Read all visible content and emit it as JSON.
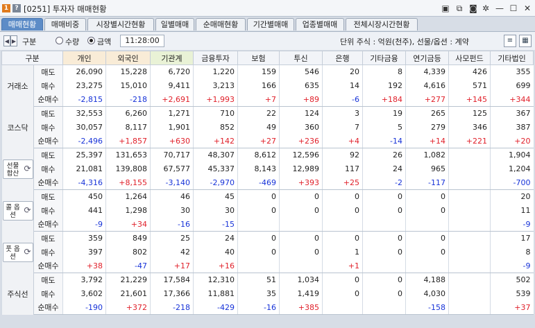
{
  "window": {
    "title": "[0251] 투자자 매매현황",
    "badge1": "1",
    "badge2": "?"
  },
  "tabs": [
    "매매현황",
    "매매비중",
    "시장별시간현황",
    "일별매매",
    "순매매현황",
    "기간별매매",
    "업종별매매",
    "전체시장시간현황"
  ],
  "toolbar": {
    "gubun_label": "구분",
    "radio_qty": "수량",
    "radio_amt": "금액",
    "time": "11:28:00",
    "unit_text": "단위 주식 : 억원(천주), 선물/옵션 : 계약"
  },
  "table": {
    "headers": [
      "구분",
      "개인",
      "외국인",
      "기관계",
      "금융투자",
      "보험",
      "투신",
      "은행",
      "기타금융",
      "연기금등",
      "사모펀드",
      "기타법인"
    ],
    "row_labels": [
      "매도",
      "매수",
      "순매수"
    ],
    "groups": [
      {
        "name": "거래소",
        "rows": [
          [
            "26,090",
            "15,228",
            "6,720",
            "1,220",
            "159",
            "546",
            "20",
            "8",
            "4,339",
            "426",
            "355"
          ],
          [
            "23,275",
            "15,010",
            "9,411",
            "3,213",
            "166",
            "635",
            "14",
            "192",
            "4,616",
            "571",
            "699"
          ],
          [
            "-2,815",
            "-218",
            "+2,691",
            "+1,993",
            "+7",
            "+89",
            "-6",
            "+184",
            "+277",
            "+145",
            "+344"
          ]
        ]
      },
      {
        "name": "코스닥",
        "rows": [
          [
            "32,553",
            "6,260",
            "1,271",
            "710",
            "22",
            "124",
            "3",
            "19",
            "265",
            "125",
            "367"
          ],
          [
            "30,057",
            "8,117",
            "1,901",
            "852",
            "49",
            "360",
            "7",
            "5",
            "279",
            "346",
            "387"
          ],
          [
            "-2,496",
            "+1,857",
            "+630",
            "+142",
            "+27",
            "+236",
            "+4",
            "-14",
            "+14",
            "+221",
            "+20"
          ]
        ]
      },
      {
        "name": "선물 합산",
        "button": true,
        "rows": [
          [
            "25,397",
            "131,653",
            "70,717",
            "48,307",
            "8,612",
            "12,596",
            "92",
            "26",
            "1,082",
            "",
            "1,904"
          ],
          [
            "21,081",
            "139,808",
            "67,577",
            "45,337",
            "8,143",
            "12,989",
            "117",
            "24",
            "965",
            "",
            "1,204"
          ],
          [
            "-4,316",
            "+8,155",
            "-3,140",
            "-2,970",
            "-469",
            "+393",
            "+25",
            "-2",
            "-117",
            "",
            "-700"
          ]
        ]
      },
      {
        "name": "콜 옵션",
        "button": true,
        "rows": [
          [
            "450",
            "1,264",
            "46",
            "45",
            "0",
            "0",
            "0",
            "0",
            "0",
            "",
            "20"
          ],
          [
            "441",
            "1,298",
            "30",
            "30",
            "0",
            "0",
            "0",
            "0",
            "0",
            "",
            "11"
          ],
          [
            "-9",
            "+34",
            "-16",
            "-15",
            "",
            "",
            "",
            "",
            "",
            "",
            "-9"
          ]
        ]
      },
      {
        "name": "풋 옵션",
        "button": true,
        "rows": [
          [
            "359",
            "849",
            "25",
            "24",
            "0",
            "0",
            "0",
            "0",
            "0",
            "",
            "17"
          ],
          [
            "397",
            "802",
            "42",
            "40",
            "0",
            "0",
            "1",
            "0",
            "0",
            "",
            "8"
          ],
          [
            "+38",
            "-47",
            "+17",
            "+16",
            "",
            "",
            "+1",
            "",
            "",
            "",
            "-9"
          ]
        ]
      },
      {
        "name": "주식선",
        "rows": [
          [
            "3,792",
            "21,229",
            "17,584",
            "12,310",
            "51",
            "1,034",
            "0",
            "0",
            "4,188",
            "",
            "502"
          ],
          [
            "3,602",
            "21,601",
            "17,366",
            "11,881",
            "35",
            "1,419",
            "0",
            "0",
            "4,030",
            "",
            "539"
          ],
          [
            "-190",
            "+372",
            "-218",
            "-429",
            "-16",
            "+385",
            "",
            "",
            "-158",
            "",
            "+37"
          ]
        ]
      }
    ]
  },
  "colors": {
    "positive": "#e0202a",
    "negative": "#1632d8",
    "tab_active": "#5d8cc7"
  }
}
